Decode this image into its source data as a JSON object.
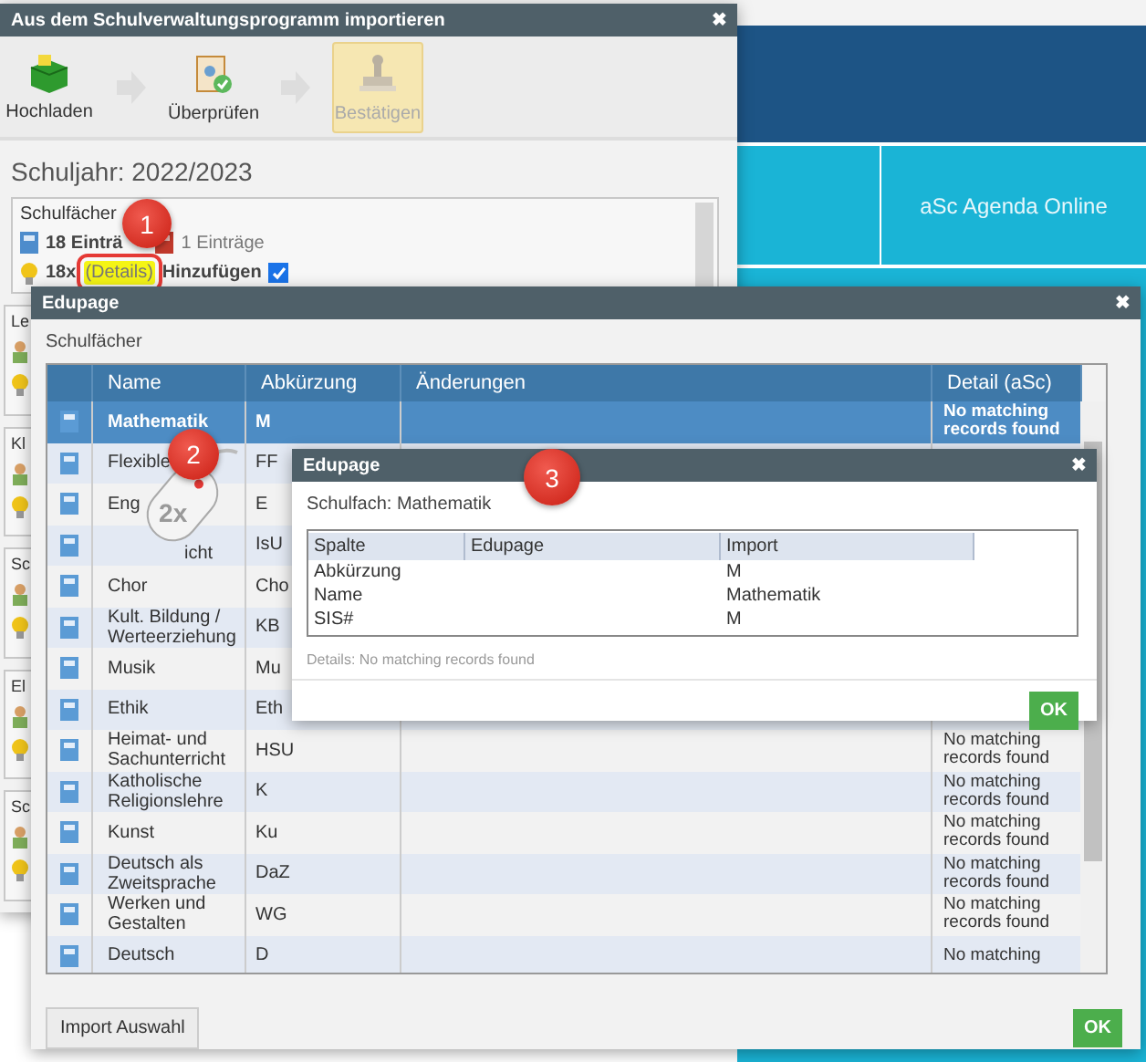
{
  "background": {
    "tiles": [
      {
        "label": "aSc Agenda Online"
      }
    ]
  },
  "import_window": {
    "title": "Aus dem Schulverwaltungsprogramm importieren",
    "close": "✖",
    "steps": [
      {
        "kind": "upload",
        "label": "Hochladen",
        "selected": false,
        "disabled": false
      },
      {
        "kind": "review",
        "label": "Überprüfen",
        "selected": false,
        "disabled": false
      },
      {
        "kind": "confirm",
        "label": "Bestätigen",
        "selected": true,
        "disabled": true
      }
    ],
    "school_year": "Schuljahr: 2022/2023",
    "subjects": {
      "title": "Schulfächer",
      "count": "18 Einträ",
      "other_count": "1 Einträge",
      "times": "18x",
      "details_link": "(Details)",
      "add_label": "Hinzufügen",
      "add_checked": true
    },
    "sections": [
      {
        "title": "Le"
      },
      {
        "title": "Kl"
      },
      {
        "title": "Sc"
      },
      {
        "title": "El"
      },
      {
        "title": "Sc"
      }
    ]
  },
  "edupage_window": {
    "title": "Edupage",
    "close": "✖",
    "subtitle": "Schulfächer",
    "columns": [
      "Name",
      "Abkürzung",
      "Änderungen",
      "Detail (aSc)"
    ],
    "rows": [
      {
        "name": "Mathematik",
        "abbr": "M",
        "detail": "No matching records found",
        "selected": true
      },
      {
        "name": "Flexible",
        "abbr": "FF",
        "selected": false
      },
      {
        "name": "Eng",
        "abbr": "E",
        "selected": false
      },
      {
        "name": "icht",
        "abbr": "IsU",
        "selected": false
      },
      {
        "name": "Chor",
        "abbr": "Cho",
        "selected": false
      },
      {
        "name": "Kult. Bildung / Werteerziehung",
        "abbr": "KB",
        "selected": false
      },
      {
        "name": "Musik",
        "abbr": "Mu",
        "selected": false
      },
      {
        "name": "Ethik",
        "abbr": "Eth",
        "selected": false
      },
      {
        "name": "Heimat- und Sachunterricht",
        "abbr": "HSU",
        "detail": "No matching records found",
        "selected": false
      },
      {
        "name": "Katholische Religionslehre",
        "abbr": "K",
        "detail": "No matching records found",
        "selected": false
      },
      {
        "name": "Kunst",
        "abbr": "Ku",
        "detail": "No matching records found",
        "selected": false
      },
      {
        "name": "Deutsch als Zweitsprache",
        "abbr": "DaZ",
        "detail": "No matching records found",
        "selected": false
      },
      {
        "name": "Werken und Gestalten",
        "abbr": "WG",
        "detail": "No matching records found",
        "selected": false
      },
      {
        "name": "Deutsch",
        "abbr": "D",
        "detail": "No matching",
        "selected": false
      }
    ],
    "buttons": [
      "Import Auswahl",
      "OK"
    ]
  },
  "detail_dialog": {
    "title": "Edupage",
    "close": "✖",
    "subtitle": "Schulfach: Mathematik",
    "columns": [
      "Spalte",
      "Edupage",
      "Import"
    ],
    "rows": [
      {
        "field": "Abkürzung",
        "import": "M"
      },
      {
        "field": "Name",
        "import": "Mathematik"
      },
      {
        "field": "SIS#",
        "import": "M"
      }
    ],
    "note": "Details: No matching records found",
    "button": "OK"
  },
  "annotations": {
    "badges": [
      "1",
      "2",
      "3"
    ],
    "mouse_label": "2x"
  }
}
